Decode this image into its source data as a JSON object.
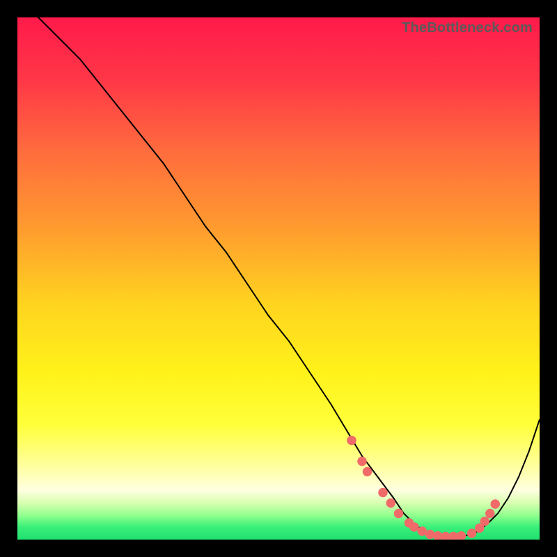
{
  "attribution": "TheBottleneck.com",
  "gradient_stops": [
    {
      "offset": 0.0,
      "color": "#ff1a4a"
    },
    {
      "offset": 0.12,
      "color": "#ff3747"
    },
    {
      "offset": 0.25,
      "color": "#ff6a3e"
    },
    {
      "offset": 0.4,
      "color": "#ff9a2f"
    },
    {
      "offset": 0.55,
      "color": "#ffd41f"
    },
    {
      "offset": 0.68,
      "color": "#fff21a"
    },
    {
      "offset": 0.78,
      "color": "#ffff3a"
    },
    {
      "offset": 0.86,
      "color": "#ffffa0"
    },
    {
      "offset": 0.905,
      "color": "#ffffe0"
    },
    {
      "offset": 0.93,
      "color": "#d8ffb0"
    },
    {
      "offset": 0.955,
      "color": "#8cff8c"
    },
    {
      "offset": 0.975,
      "color": "#3cf07a"
    },
    {
      "offset": 1.0,
      "color": "#1fe070"
    }
  ],
  "curve_color": "#000000",
  "marker_color": "#f06a6a",
  "chart_data": {
    "type": "line",
    "title": "",
    "xlabel": "",
    "ylabel": "",
    "xlim": [
      0,
      100
    ],
    "ylim": [
      0,
      100
    ],
    "series": [
      {
        "name": "bottleneck-curve",
        "x": [
          0,
          4,
          8,
          12,
          16,
          20,
          24,
          28,
          32,
          36,
          40,
          44,
          48,
          52,
          56,
          60,
          63,
          66,
          69,
          72,
          74,
          76,
          78,
          80,
          82,
          84,
          86,
          88,
          90,
          92,
          94,
          96,
          98,
          100
        ],
        "y": [
          103,
          100,
          96,
          92,
          87,
          82,
          77,
          72,
          66,
          60,
          55,
          49,
          43,
          38,
          32,
          26,
          21,
          16,
          12,
          8,
          5,
          3,
          1.5,
          0.8,
          0.5,
          0.5,
          0.8,
          1.5,
          3,
          5,
          8,
          12,
          17,
          23
        ]
      }
    ],
    "markers": {
      "name": "highlight-points",
      "x": [
        64,
        66,
        67,
        70,
        71.5,
        73,
        75,
        76,
        77.5,
        79,
        80.5,
        82,
        83.5,
        85,
        87,
        88.5,
        89.5,
        90.5,
        91.5
      ],
      "y": [
        19,
        15,
        13,
        9,
        7,
        5,
        3.2,
        2.4,
        1.6,
        1.0,
        0.7,
        0.6,
        0.6,
        0.7,
        1.2,
        2.2,
        3.5,
        5.0,
        6.8
      ]
    }
  }
}
